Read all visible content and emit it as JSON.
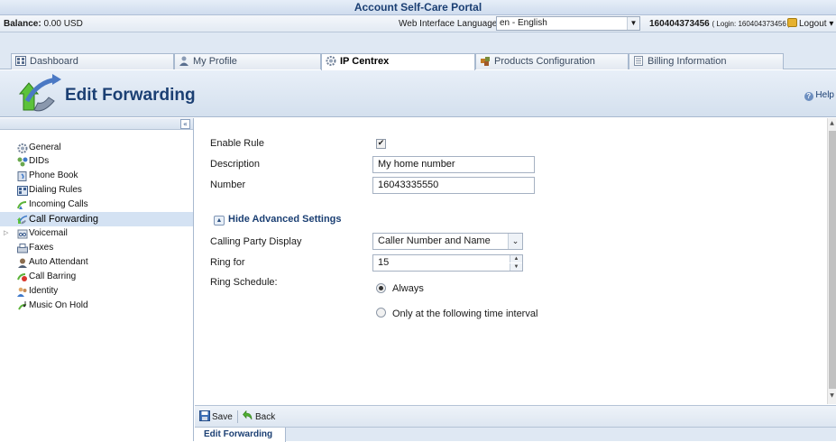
{
  "portal": {
    "title": "Account Self-Care Portal"
  },
  "status": {
    "balance_label": "Balance:",
    "balance_value": "0.00 USD",
    "language_label": "Web Interface Language:",
    "language_value": "en - English",
    "account_id": "160404373456",
    "login_text": "( Login: 160404373456 )",
    "logout_label": "Logout"
  },
  "tabs": [
    {
      "label": "Dashboard",
      "icon": "dashboard-icon"
    },
    {
      "label": "My Profile",
      "icon": "profile-icon"
    },
    {
      "label": "IP Centrex",
      "icon": "gear-icon"
    },
    {
      "label": "Products Configuration",
      "icon": "products-icon"
    },
    {
      "label": "Billing Information",
      "icon": "billing-icon"
    }
  ],
  "header": {
    "page_title": "Edit Forwarding",
    "help_label": "Help"
  },
  "sidebar": {
    "collapse_symbol": "«",
    "items": [
      {
        "label": "General",
        "icon": "gear-icon"
      },
      {
        "label": "DIDs",
        "icon": "dids-icon"
      },
      {
        "label": "Phone Book",
        "icon": "phone-book-icon"
      },
      {
        "label": "Dialing Rules",
        "icon": "dialing-rules-icon"
      },
      {
        "label": "Incoming Calls",
        "icon": "incoming-calls-icon"
      },
      {
        "label": "Call Forwarding",
        "icon": "call-forwarding-icon",
        "selected": true
      },
      {
        "label": "Voicemail",
        "icon": "voicemail-icon",
        "expandable": true
      },
      {
        "label": "Faxes",
        "icon": "fax-icon"
      },
      {
        "label": "Auto Attendant",
        "icon": "auto-attendant-icon"
      },
      {
        "label": "Call Barring",
        "icon": "call-barring-icon"
      },
      {
        "label": "Identity",
        "icon": "identity-icon"
      },
      {
        "label": "Music On Hold",
        "icon": "music-icon"
      }
    ]
  },
  "form": {
    "enable_rule_label": "Enable Rule",
    "enable_rule_checked": true,
    "description_label": "Description",
    "description_value": "My home number",
    "number_label": "Number",
    "number_value": "16043335550",
    "advanced_toggle": "Hide Advanced Settings",
    "calling_party_label": "Calling Party Display",
    "calling_party_value": "Caller Number and Name",
    "ring_for_label": "Ring for",
    "ring_for_value": "15",
    "ring_schedule_label": "Ring Schedule:",
    "schedule_options": [
      {
        "label": "Always",
        "checked": true
      },
      {
        "label": "Only at the following time interval",
        "checked": false
      }
    ]
  },
  "toolbar": {
    "save_label": "Save",
    "back_label": "Back"
  },
  "bottom_tab": {
    "label": "Edit Forwarding"
  },
  "colors": {
    "brand_blue": "#1b3f73",
    "selected_row": "#d4e2f3",
    "header_gradient": "#d4e0ee"
  }
}
